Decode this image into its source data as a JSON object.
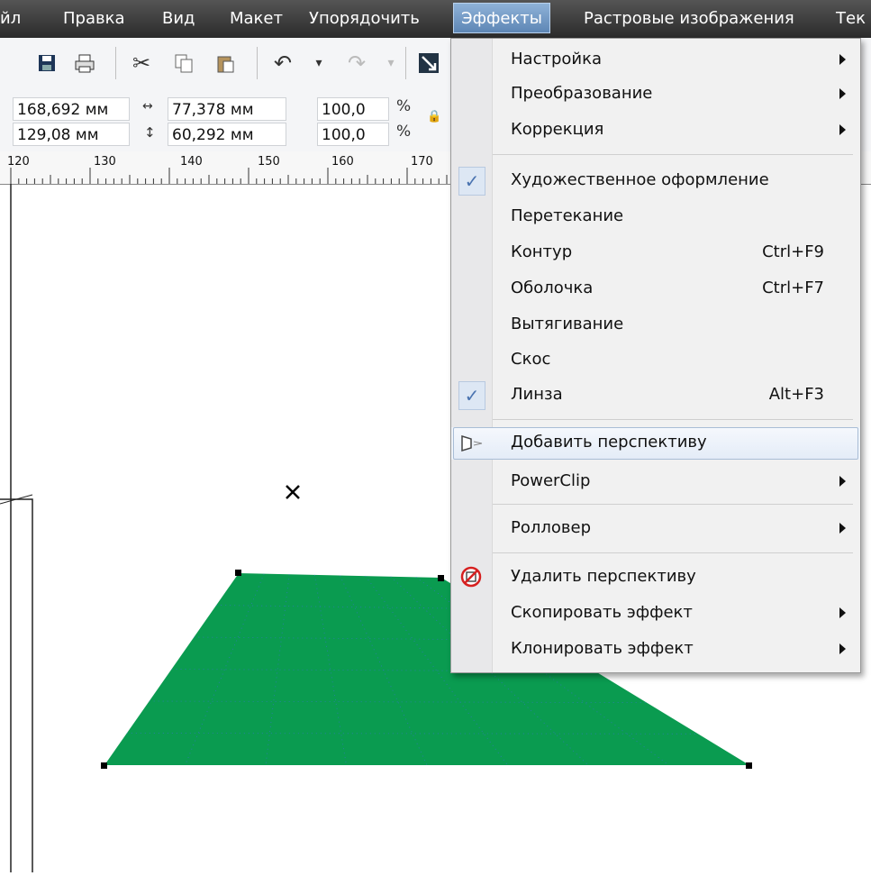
{
  "menubar": {
    "items": [
      "йл",
      "Правка",
      "Вид",
      "Макет",
      "Упорядочить",
      "Эффекты",
      "Растровые изображения",
      "Тек"
    ]
  },
  "properties": {
    "x": "168,692 мм",
    "y": "129,08 мм",
    "width": "77,378 мм",
    "height": "60,292 мм",
    "scale_x": "100,0",
    "scale_y": "100,0",
    "percent": "%"
  },
  "ruler": {
    "labels": [
      "120",
      "130",
      "140",
      "150",
      "160",
      "170"
    ]
  },
  "effects_menu": {
    "items": [
      {
        "label": "Настройка"
      },
      {
        "label": "Преобразование"
      },
      {
        "label": "Коррекция"
      },
      {
        "label": "Художественное оформление"
      },
      {
        "label": "Перетекание"
      },
      {
        "label": "Контур",
        "shortcut": "Ctrl+F9"
      },
      {
        "label": "Оболочка",
        "shortcut": "Ctrl+F7"
      },
      {
        "label": "Вытягивание"
      },
      {
        "label": "Скос"
      },
      {
        "label": "Линза",
        "shortcut": "Alt+F3"
      },
      {
        "label": "Добавить перспективу"
      },
      {
        "label": "PowerClip"
      },
      {
        "label": "Ролловер"
      },
      {
        "label": "Удалить перспективу"
      },
      {
        "label": "Скопировать эффект"
      },
      {
        "label": "Клонировать эффект"
      }
    ]
  },
  "colors": {
    "shape_fill": "#0a9b50",
    "menubar_bg": "#2b2b2b",
    "menu_highlight": "#e4ecf7"
  }
}
